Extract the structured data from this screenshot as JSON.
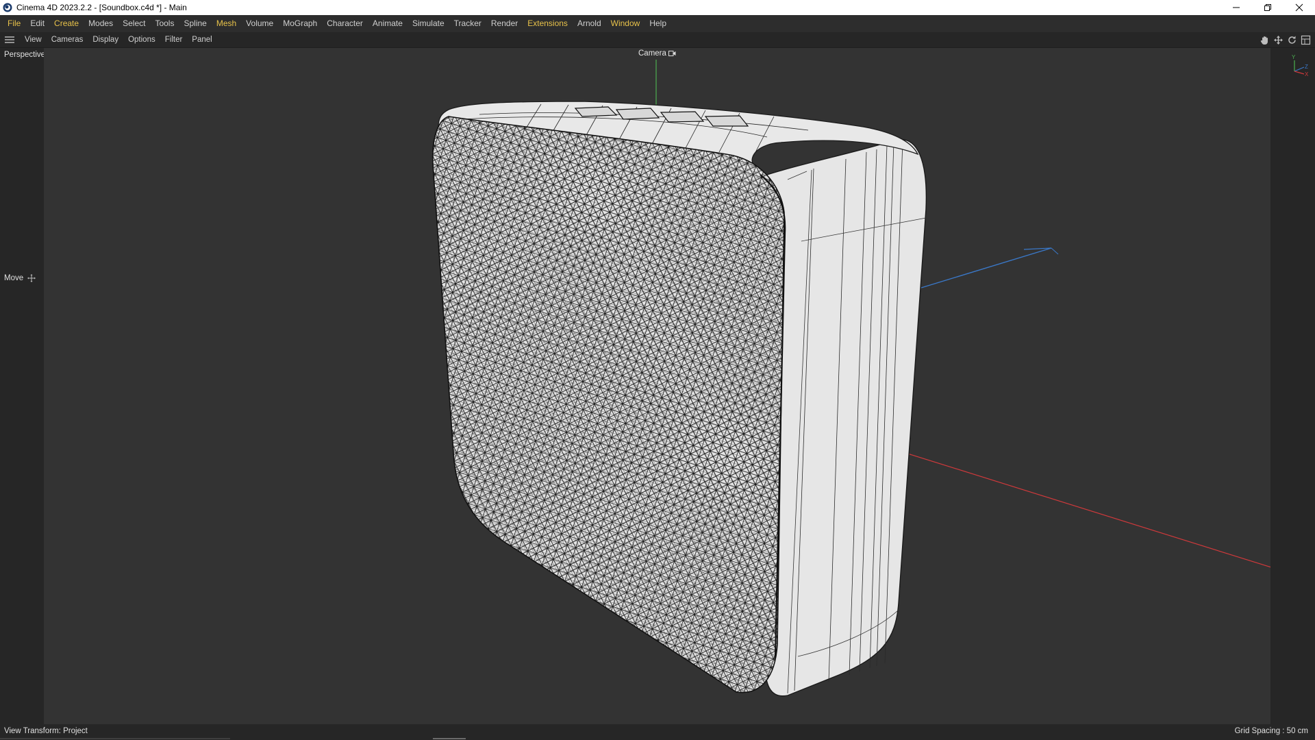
{
  "window": {
    "title": "Cinema 4D 2023.2.2 - [Soundbox.c4d *] - Main",
    "controls": [
      "minimize-icon",
      "restore-icon",
      "close-icon"
    ]
  },
  "menubar": {
    "items": [
      "File",
      "Edit",
      "Create",
      "Modes",
      "Select",
      "Tools",
      "Spline",
      "Mesh",
      "Volume",
      "MoGraph",
      "Character",
      "Animate",
      "Simulate",
      "Tracker",
      "Render",
      "Extensions",
      "Arnold",
      "Window",
      "Help"
    ]
  },
  "viewport_menu": {
    "items": [
      "View",
      "Cameras",
      "Display",
      "Options",
      "Filter",
      "Panel"
    ],
    "nav_icons": [
      "pan-hand-icon",
      "move-arrows-icon",
      "rotate-icon",
      "maximize-viewport-icon"
    ]
  },
  "viewport": {
    "view_name": "Perspective",
    "camera_label": "Camera",
    "active_tool": "Move",
    "axis_labels": {
      "y": "Y",
      "z": "Z",
      "x": "X"
    }
  },
  "status": {
    "view_transform": "View Transform: Project",
    "grid_spacing": "Grid Spacing : 50 cm"
  },
  "colors": {
    "accent": "#e8c24a",
    "axis_x": "#d0393b",
    "axis_y": "#4caf50",
    "axis_z": "#3a78c8"
  }
}
